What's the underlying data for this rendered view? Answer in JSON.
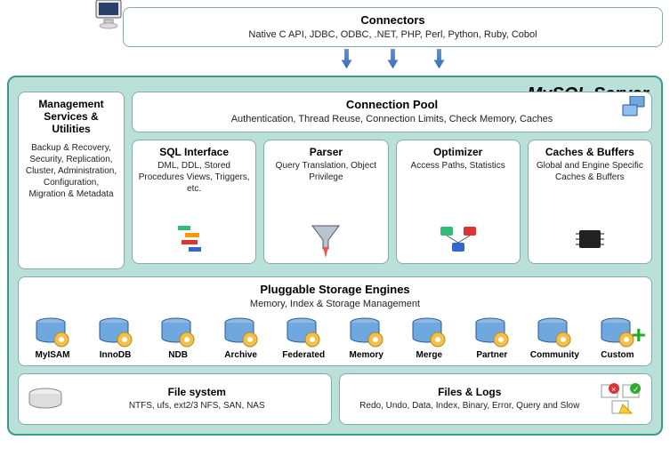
{
  "connectors": {
    "title": "Connectors",
    "sub": "Native C API, JDBC, ODBC, .NET, PHP, Perl, Python, Ruby, Cobol"
  },
  "server_title": "MySQL Server",
  "mgmt": {
    "title": "Management Services & Utilities",
    "sub": "Backup & Recovery, Security, Replication, Cluster, Administration, Configuration, Migration & Metadata"
  },
  "cpool": {
    "title": "Connection Pool",
    "sub": "Authentication, Thread Reuse, Connection Limits, Check Memory, Caches"
  },
  "cols": {
    "sql": {
      "title": "SQL Interface",
      "sub": "DML, DDL, Stored Procedures Views, Triggers, etc."
    },
    "parser": {
      "title": "Parser",
      "sub": "Query Translation, Object Privilege"
    },
    "optimizer": {
      "title": "Optimizer",
      "sub": "Access Paths, Statistics"
    },
    "caches": {
      "title": "Caches & Buffers",
      "sub": "Global and Engine Specific Caches & Buffers"
    }
  },
  "engines": {
    "title": "Pluggable Storage Engines",
    "sub": "Memory, Index & Storage Management",
    "list": [
      "MyISAM",
      "InnoDB",
      "NDB",
      "Archive",
      "Federated",
      "Memory",
      "Merge",
      "Partner",
      "Community",
      "Custom"
    ]
  },
  "fs": {
    "title": "File system",
    "sub": "NTFS, ufs, ext2/3 NFS, SAN, NAS"
  },
  "logs": {
    "title": "Files & Logs",
    "sub": "Redo, Undo, Data, Index, Binary, Error, Query and Slow"
  }
}
